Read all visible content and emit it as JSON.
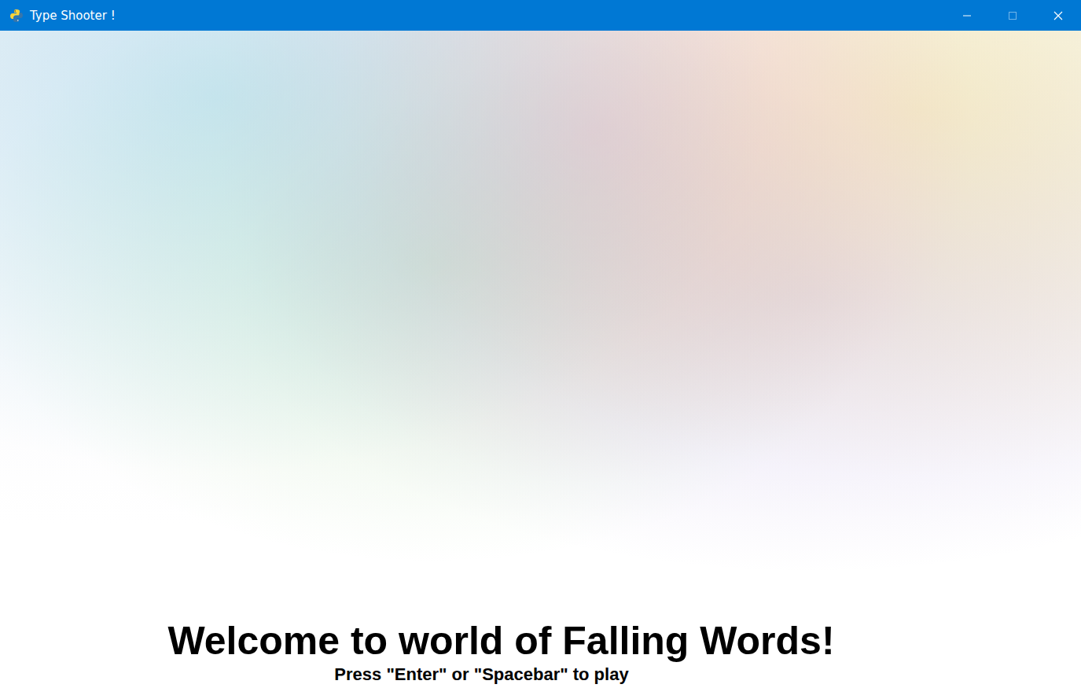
{
  "window": {
    "title": "Type Shooter !"
  },
  "screen": {
    "heading": "Welcome to world of Falling Words!",
    "prompt": "Press \"Enter\" or \"Spacebar\" to play"
  }
}
